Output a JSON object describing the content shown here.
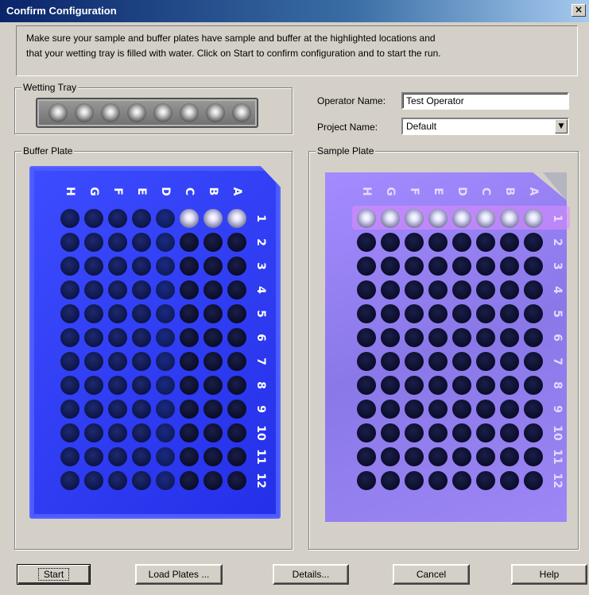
{
  "window": {
    "title": "Confirm Configuration",
    "close_label": "×"
  },
  "instructions": {
    "line1": "Make sure your sample and buffer plates have sample and buffer at the highlighted locations and",
    "line2": "that your wetting tray is filled with water.  Click on Start to confirm configuration and to start the run."
  },
  "wetting_tray": {
    "label": "Wetting Tray",
    "wells": 8
  },
  "operator": {
    "label": "Operator Name:",
    "value": "Test Operator"
  },
  "project": {
    "label": "Project Name:",
    "value": "Default",
    "arrow": "▼"
  },
  "buffer_plate": {
    "label": "Buffer Plate",
    "columns": [
      "H",
      "G",
      "F",
      "E",
      "D",
      "C",
      "B",
      "A"
    ],
    "rows": [
      "1",
      "2",
      "3",
      "4",
      "5",
      "6",
      "7",
      "8",
      "9",
      "10",
      "11",
      "12"
    ],
    "highlighted_row": "1"
  },
  "sample_plate": {
    "label": "Sample Plate",
    "columns": [
      "H",
      "G",
      "F",
      "E",
      "D",
      "C",
      "B",
      "A"
    ],
    "rows": [
      "1",
      "2",
      "3",
      "4",
      "5",
      "6",
      "7",
      "8",
      "9",
      "10",
      "11",
      "12"
    ],
    "highlighted_row": "1"
  },
  "buttons": {
    "start": "Start",
    "load_plates": "Load Plates ...",
    "details": "Details...",
    "cancel": "Cancel",
    "help": "Help"
  },
  "colors": {
    "buffer_plate": "#2f3cf5",
    "sample_plate": "#9a84f5",
    "highlight_row": "#d98cff"
  }
}
